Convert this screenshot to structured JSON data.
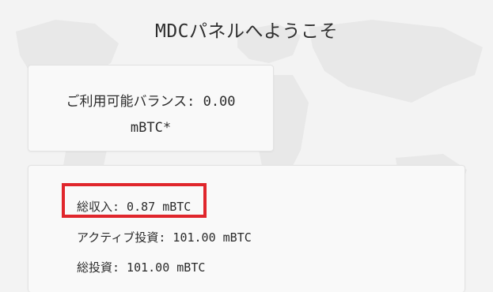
{
  "header": {
    "title": "MDCパネルへようこそ"
  },
  "balance": {
    "label": "ご利用可能バランス: 0.00",
    "unit": "mBTC*"
  },
  "stats": {
    "total_income": "総収入: 0.87 mBTC",
    "active_investment": "アクティブ投資: 101.00 mBTC",
    "total_investment": "総投資: 101.00 mBTC"
  },
  "colors": {
    "background": "#f3f3f3",
    "card": "#f9f9f9",
    "highlight": "#e0262c"
  },
  "icons": {
    "background_decoration": "world-map-watermark"
  }
}
